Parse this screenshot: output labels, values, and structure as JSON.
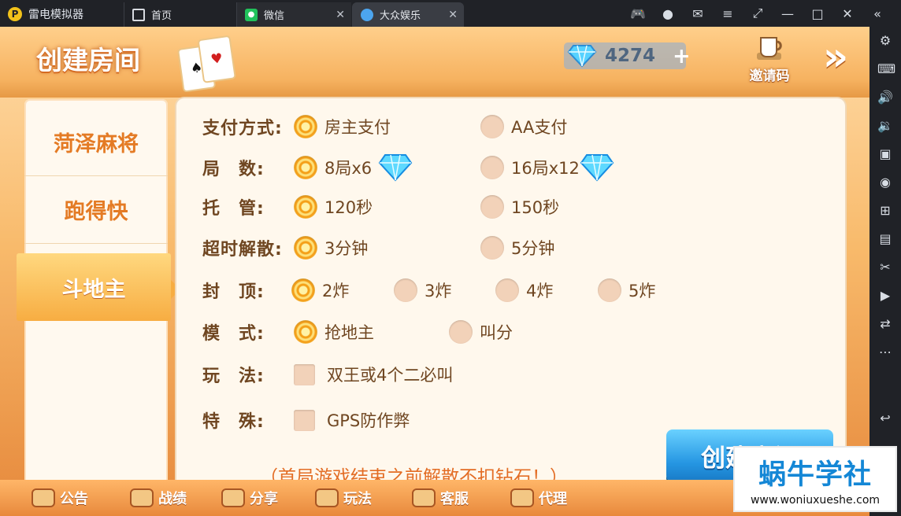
{
  "window": {
    "app_title": "雷电模拟器",
    "tabs": [
      {
        "label": "首页"
      },
      {
        "label": "微信"
      },
      {
        "label": "大众娱乐"
      }
    ]
  },
  "header": {
    "title": "创建房间",
    "diamond_count": "4274",
    "invite_label": "邀请码"
  },
  "games": [
    {
      "label": "菏泽麻将"
    },
    {
      "label": "跑得快"
    },
    {
      "label": "斗地主"
    }
  ],
  "form": {
    "rows": [
      {
        "label": "支付方式:",
        "options": [
          "房主支付",
          "AA支付"
        ]
      },
      {
        "label": "局　数:",
        "options": [
          "8局x6",
          "16局x12"
        ]
      },
      {
        "label": "托　管:",
        "options": [
          "120秒",
          "150秒"
        ]
      },
      {
        "label": "超时解散:",
        "options": [
          "3分钟",
          "5分钟"
        ]
      },
      {
        "label": "封　顶:",
        "options": [
          "2炸",
          "3炸",
          "4炸",
          "5炸"
        ]
      },
      {
        "label": "模　式:",
        "options": [
          "抢地主",
          "叫分"
        ]
      },
      {
        "label": "玩　法:",
        "options": [
          "双王或4个二必叫"
        ]
      },
      {
        "label": "特　殊:",
        "options": [
          "GPS防作弊"
        ]
      }
    ],
    "note": "（首局游戏结束之前解散不扣钻石！）",
    "create_button": "创建房间"
  },
  "bottom_nav": [
    "公告",
    "战绩",
    "分享",
    "玩法",
    "客服",
    "代理"
  ],
  "watermark": {
    "main": "蜗牛学社",
    "url": "www.woniuxueshe.com"
  },
  "colors": {
    "accent": "#f5a11d",
    "primary_text": "#6f4621",
    "note": "#e36d25",
    "button": "#2596e2"
  }
}
